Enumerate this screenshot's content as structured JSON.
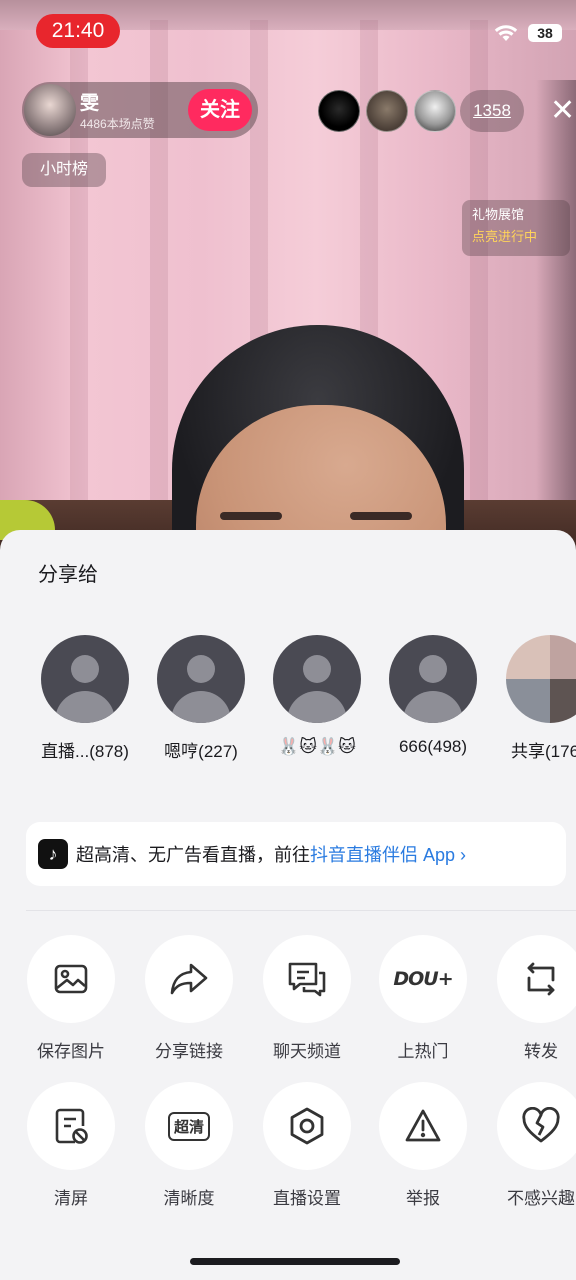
{
  "status_bar": {
    "time": "21:40",
    "battery": "38"
  },
  "host": {
    "name": "雯",
    "likes": "4486本场点赞",
    "follow_label": "关注"
  },
  "viewers": {
    "count": "1358"
  },
  "overlay": {
    "hour_rank": "小时榜",
    "gift_hall_title": "礼物展馆",
    "gift_hall_status": "点亮进行中"
  },
  "share_sheet": {
    "title": "分享给",
    "contacts": [
      {
        "name": "直播...(878)"
      },
      {
        "name": "嗯哼(227)"
      },
      {
        "name": "🐰🐱🐰🐱"
      },
      {
        "name": "666(498)"
      },
      {
        "name": "共享(176"
      }
    ],
    "banner": {
      "text": "超高清、无广告看直播，前往 ",
      "link": "抖音直播伴侣 App ›"
    },
    "actions_row1": [
      {
        "label": "保存图片",
        "icon": "image-icon"
      },
      {
        "label": "分享链接",
        "icon": "share-arrow-icon"
      },
      {
        "label": "聊天频道",
        "icon": "chat-icon"
      },
      {
        "label": "上热门",
        "icon": "dou-plus-icon",
        "icon_text": "DOU+"
      },
      {
        "label": "转发",
        "icon": "repost-icon"
      }
    ],
    "actions_row2": [
      {
        "label": "清屏",
        "icon": "clear-screen-icon"
      },
      {
        "label": "清晰度",
        "icon": "hd-icon",
        "icon_text": "超清"
      },
      {
        "label": "直播设置",
        "icon": "settings-hex-icon"
      },
      {
        "label": "举报",
        "icon": "report-icon"
      },
      {
        "label": "不感兴趣",
        "icon": "broken-heart-icon"
      }
    ]
  },
  "colors": {
    "follow": "#ff2a5f",
    "time_pill": "#e8262d",
    "link": "#2a7be0",
    "gift_status": "#ffd45a"
  }
}
